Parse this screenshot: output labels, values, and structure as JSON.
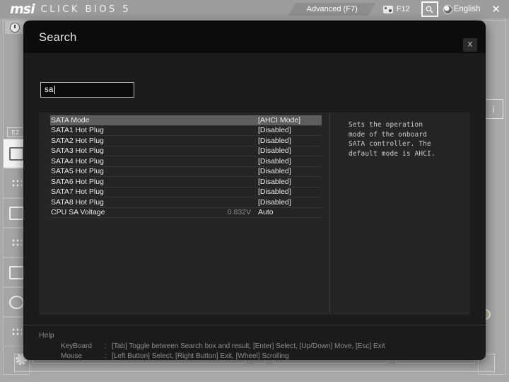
{
  "header": {
    "brand": "msi",
    "product": "CLICK BIOS 5",
    "mode_tab": "Advanced (F7)",
    "screenshot_key": "F12",
    "language": "English",
    "close_label": "✕",
    "icons": {
      "camera": "camera-icon",
      "search": "search-icon",
      "globe": "globe-icon"
    }
  },
  "background": {
    "ez_label": "EZ",
    "clock": "clock-icon"
  },
  "modal": {
    "title": "Search",
    "close_label": "X",
    "search": {
      "value": "sa",
      "placeholder": ""
    },
    "results": [
      {
        "name": "SATA Mode",
        "extra": "",
        "value": "[AHCI Mode]",
        "selected": true
      },
      {
        "name": "SATA1 Hot Plug",
        "extra": "",
        "value": "[Disabled]",
        "selected": false
      },
      {
        "name": "SATA2 Hot Plug",
        "extra": "",
        "value": "[Disabled]",
        "selected": false
      },
      {
        "name": "SATA3 Hot Plug",
        "extra": "",
        "value": "[Disabled]",
        "selected": false
      },
      {
        "name": "SATA4 Hot Plug",
        "extra": "",
        "value": "[Disabled]",
        "selected": false
      },
      {
        "name": "SATA5 Hot Plug",
        "extra": "",
        "value": "[Disabled]",
        "selected": false
      },
      {
        "name": "SATA6 Hot Plug",
        "extra": "",
        "value": "[Disabled]",
        "selected": false
      },
      {
        "name": "SATA7 Hot Plug",
        "extra": "",
        "value": "[Disabled]",
        "selected": false
      },
      {
        "name": "SATA8 Hot Plug",
        "extra": "",
        "value": "[Disabled]",
        "selected": false
      },
      {
        "name": "CPU SA Voltage",
        "extra": "0.832V",
        "value": "Auto",
        "selected": false
      }
    ],
    "description": "Sets the operation\nmode of the onboard\nSATA controller. The\ndefault mode is AHCI.",
    "help": {
      "title": "Help",
      "keyboard_label": "KeyBoard",
      "keyboard_colon": ":",
      "keyboard_text": "[Tab] Toggle between Search box and result,   [Enter] Select,   [Up/Down] Move,   [Esc] Exit",
      "mouse_label": "Mouse",
      "mouse_colon": ":",
      "mouse_text": "[Left Button] Select,   [Right Button] Exit,   [Wheel] Scrolling"
    }
  },
  "colors": {
    "desktop": "#a9a9a9",
    "modal_bg": "#0c0c0c",
    "modal_body": "#1b1b1b",
    "panel": "#252525",
    "selected_row": "#5e5e5e",
    "text": "#e9e9e9",
    "muted": "#8d8d8d"
  }
}
